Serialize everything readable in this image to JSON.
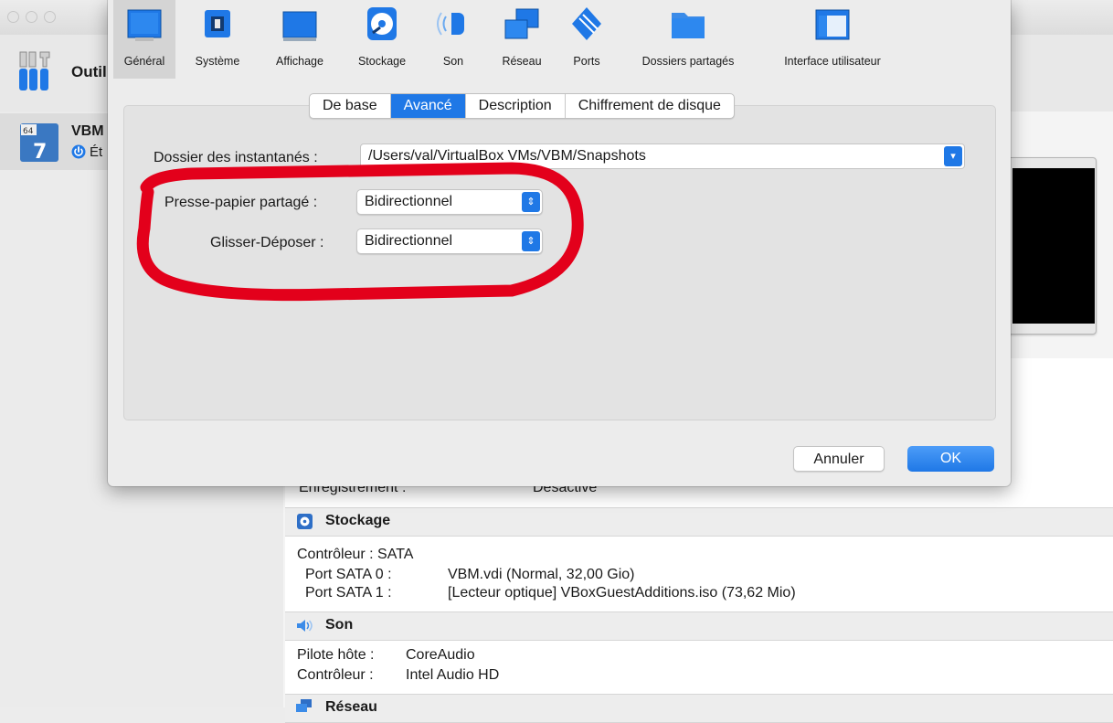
{
  "manager": {
    "tools_label": "Outil",
    "vm_name": "VBM",
    "vm_state": "Ét",
    "recording_label": "Enregistrement :",
    "recording_value": "Désactivé"
  },
  "details": {
    "storage": {
      "title": "Stockage",
      "controller": "Contrôleur : SATA",
      "ports": [
        {
          "label": "Port SATA 0 :",
          "value": "VBM.vdi (Normal, 32,00 Gio)"
        },
        {
          "label": "Port SATA 1 :",
          "value": "[Lecteur optique] VBoxGuestAdditions.iso (73,62 Mio)"
        }
      ]
    },
    "audio": {
      "title": "Son",
      "host_label": "Pilote hôte :",
      "host_value": "CoreAudio",
      "ctrl_label": "Contrôleur :",
      "ctrl_value": "Intel Audio HD"
    },
    "network": {
      "title": "Réseau"
    }
  },
  "dialog": {
    "toolbar": [
      {
        "label": "Général",
        "icon": "general-icon"
      },
      {
        "label": "Système",
        "icon": "chip-icon"
      },
      {
        "label": "Affichage",
        "icon": "display-icon"
      },
      {
        "label": "Stockage",
        "icon": "storage-icon"
      },
      {
        "label": "Son",
        "icon": "speaker-icon"
      },
      {
        "label": "Réseau",
        "icon": "network-icon"
      },
      {
        "label": "Ports",
        "icon": "ports-icon"
      },
      {
        "label": "Dossiers partagés",
        "icon": "folder-icon"
      },
      {
        "label": "Interface utilisateur",
        "icon": "window-icon"
      }
    ],
    "tabs": [
      "De base",
      "Avancé",
      "Description",
      "Chiffrement de disque"
    ],
    "active_tab": "Avancé",
    "snapshot_label": "Dossier des instantanés :",
    "snapshot_value": "/Users/val/VirtualBox VMs/VBM/Snapshots",
    "clipboard_label": "Presse-papier partagé :",
    "clipboard_value": "Bidirectionnel",
    "dnd_label": "Glisser-Déposer :",
    "dnd_value": "Bidirectionnel",
    "cancel_label": "Annuler",
    "ok_label": "OK"
  },
  "colors": {
    "accent": "#1f78e6",
    "annotation": "#e3001b"
  }
}
